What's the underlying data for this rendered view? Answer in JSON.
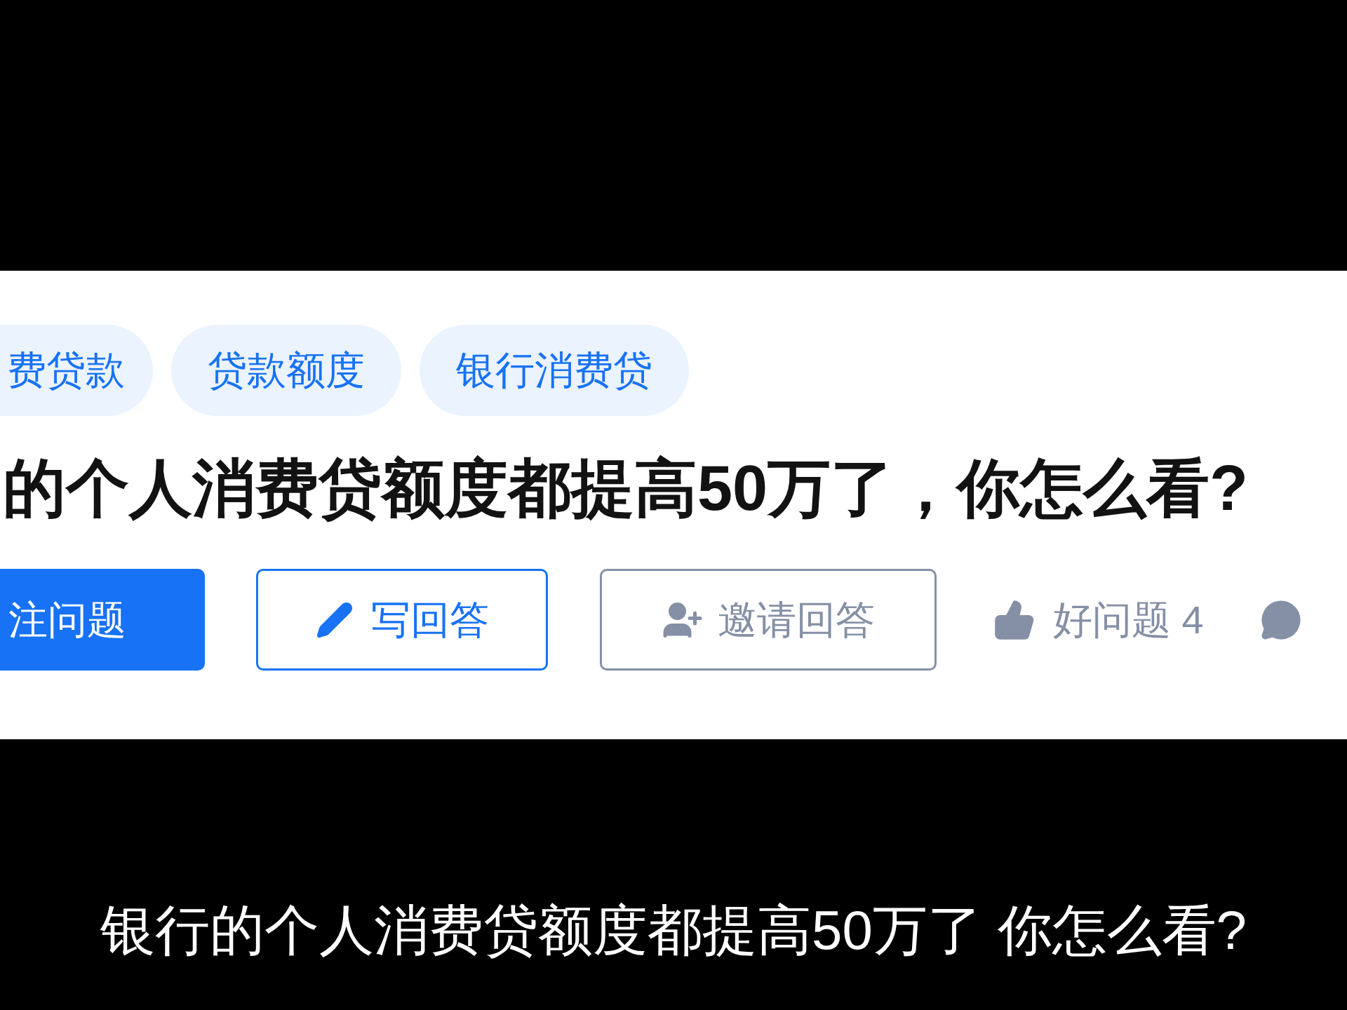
{
  "tags": [
    {
      "label": "费贷款"
    },
    {
      "label": "贷款额度"
    },
    {
      "label": "银行消费贷"
    }
  ],
  "question_title": "的个人消费贷额度都提高50万了，你怎么看?",
  "actions": [
    {
      "kind": "primary",
      "label": "注问题"
    },
    {
      "kind": "outline_blue",
      "label": "写回答"
    },
    {
      "kind": "outline_gray",
      "label": "邀请回答"
    },
    {
      "kind": "plain",
      "label": "好问题 4"
    },
    {
      "kind": "icon"
    }
  ],
  "subtitle": "银行的个人消费贷额度都提高50万了 你怎么看?"
}
